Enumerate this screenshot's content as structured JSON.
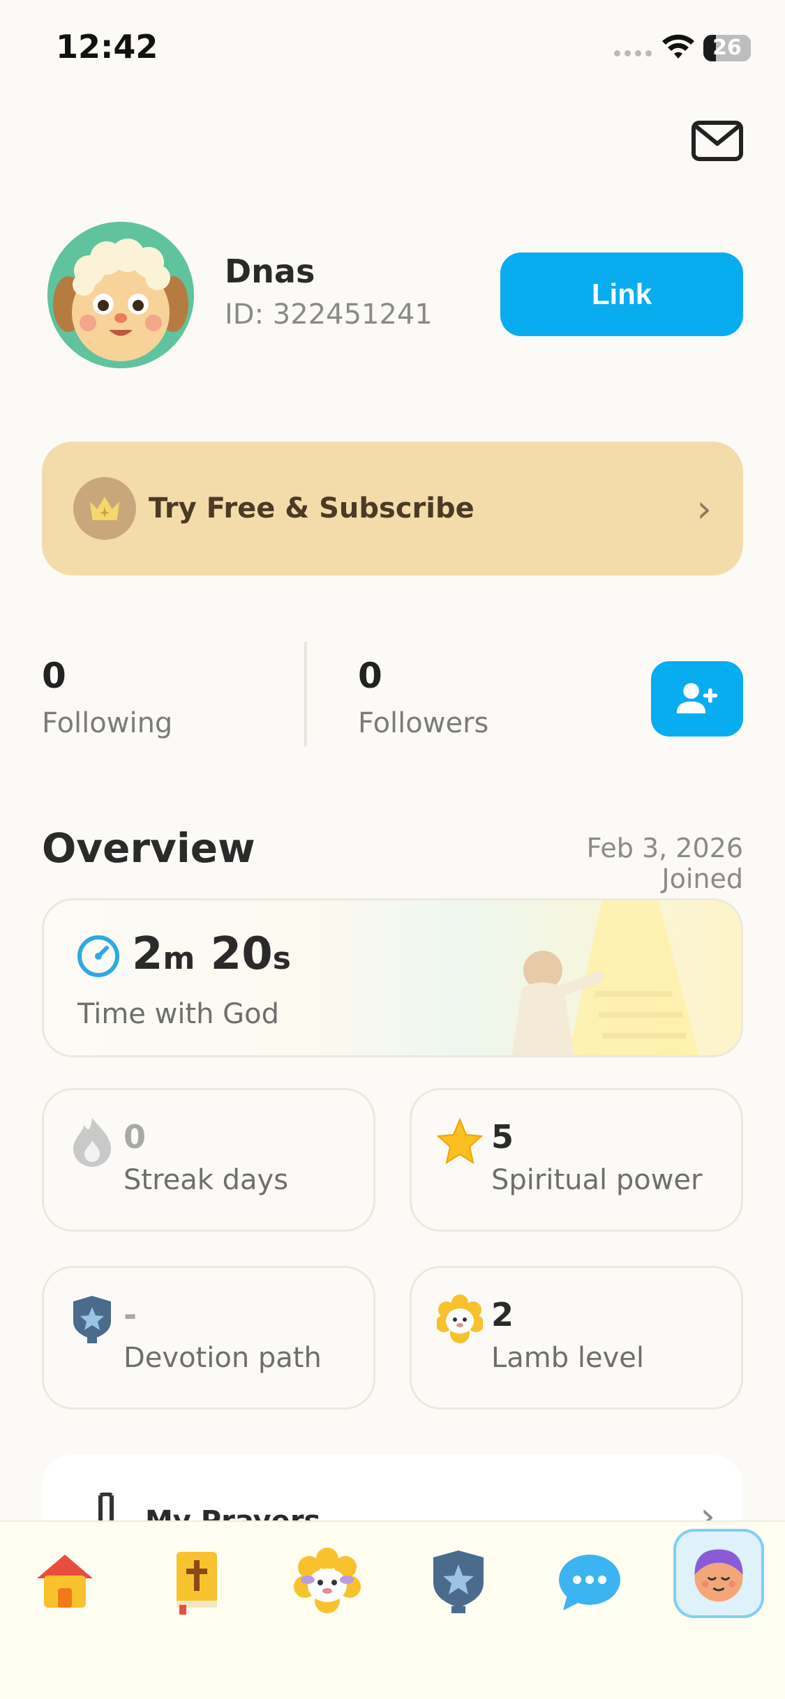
{
  "status_bar": {
    "time": "12:42",
    "battery": "26"
  },
  "profile": {
    "name": "Dnas",
    "id": "ID: 322451241",
    "link_label": "Link"
  },
  "subscribe": {
    "label": "Try Free & Subscribe"
  },
  "social": {
    "following_count": "0",
    "following_label": "Following",
    "followers_count": "0",
    "followers_label": "Followers"
  },
  "overview": {
    "title": "Overview",
    "joined": "Feb 3, 2026 Joined",
    "time_with_god": {
      "minutes": "2",
      "m_unit": "m",
      "seconds": "20",
      "s_unit": "s",
      "label": "Time with God"
    },
    "stats": [
      {
        "value": "0",
        "label": "Streak days",
        "icon": "flame-icon"
      },
      {
        "value": "5",
        "label": "Spiritual power",
        "icon": "star-icon"
      },
      {
        "value": "-",
        "label": "Devotion path",
        "icon": "shield-badge-icon"
      },
      {
        "value": "2",
        "label": "Lamb level",
        "icon": "lamb-icon"
      }
    ]
  },
  "prayers": {
    "title": "My Prayers"
  },
  "tabbar": [
    "home-icon",
    "bible-icon",
    "lamb-icon",
    "shield-icon",
    "chat-icon",
    "profile-avatar-icon"
  ],
  "colors": {
    "accent": "#08adf0",
    "subscribe_bg": "#f3dcaa",
    "background": "#fcfaf6"
  }
}
